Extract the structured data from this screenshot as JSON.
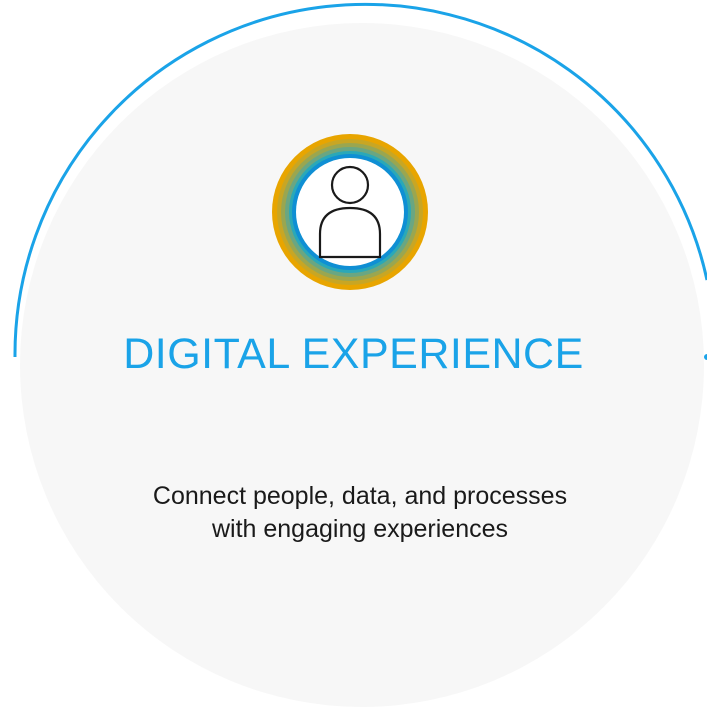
{
  "card": {
    "title": "DIGITAL EXPERIENCE",
    "description": "Connect people, data, and processes with engaging experiences",
    "icon": "user-icon"
  },
  "colors": {
    "accent": "#1aa3e8",
    "ring_gold": "#e8a500",
    "ring_teal": "#2aa8b8",
    "card_fill": "#f7f7f7",
    "text": "#1a1a1a"
  }
}
